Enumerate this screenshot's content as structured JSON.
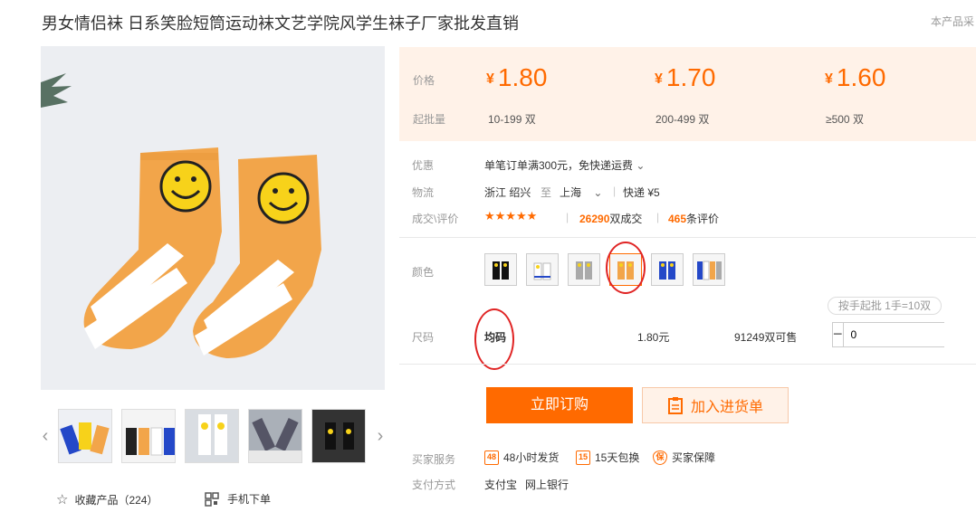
{
  "product": {
    "title": "男女情侣袜 日系笑脸短筒运动袜文艺学院风学生袜子厂家批发直销",
    "top_note": "本产品采"
  },
  "gallery": {
    "thumbnails": [
      "thumb-1",
      "thumb-2",
      "thumb-3",
      "thumb-4",
      "thumb-5"
    ]
  },
  "actions": {
    "favorite_label": "收藏产品（224）",
    "mobile_label": "手机下单"
  },
  "pricing": {
    "price_label": "价格",
    "moq_label": "起批量",
    "currency": "¥",
    "tiers": [
      {
        "price": "1.80",
        "range": "10-199 双"
      },
      {
        "price": "1.70",
        "range": "200-499 双"
      },
      {
        "price": "1.60",
        "range": "≥500 双"
      }
    ]
  },
  "details": {
    "promo_label": "优惠",
    "promo_text": "单笔订单满300元，免快递运费",
    "logistics_label": "物流",
    "from": "浙江 绍兴",
    "to_word": "至",
    "dest": "上海",
    "shipping": "快递 ¥5",
    "deals_label": "成交\\评价",
    "stars": "★★★★★",
    "deal_count": "26290",
    "deal_suffix": "双成交",
    "review_count": "465",
    "review_suffix": "条评价"
  },
  "color": {
    "label": "颜色",
    "selected_index": 3,
    "swatches": [
      "black",
      "white",
      "grey",
      "orange",
      "blue",
      "mixed"
    ]
  },
  "size": {
    "label": "尺码",
    "value": "均码",
    "price": "1.80元",
    "stock": "91249双可售",
    "order_note": "按手起批 1手=10双",
    "quantity": "0",
    "minus": "−",
    "plus": "+"
  },
  "buttons": {
    "buy": "立即订购",
    "cart": "加入进货单"
  },
  "services": {
    "label": "买家服务",
    "items": [
      "48小时发货",
      "15天包换",
      "买家保障"
    ],
    "icons": [
      "48",
      "15",
      "保"
    ],
    "payment_label": "支付方式",
    "payments": [
      "支付宝",
      "网上银行"
    ]
  },
  "colors": {
    "accent": "#ff6a00",
    "price_bg": "#fff2e8",
    "annotation": "#e02424",
    "sock": "#f2a54a"
  }
}
